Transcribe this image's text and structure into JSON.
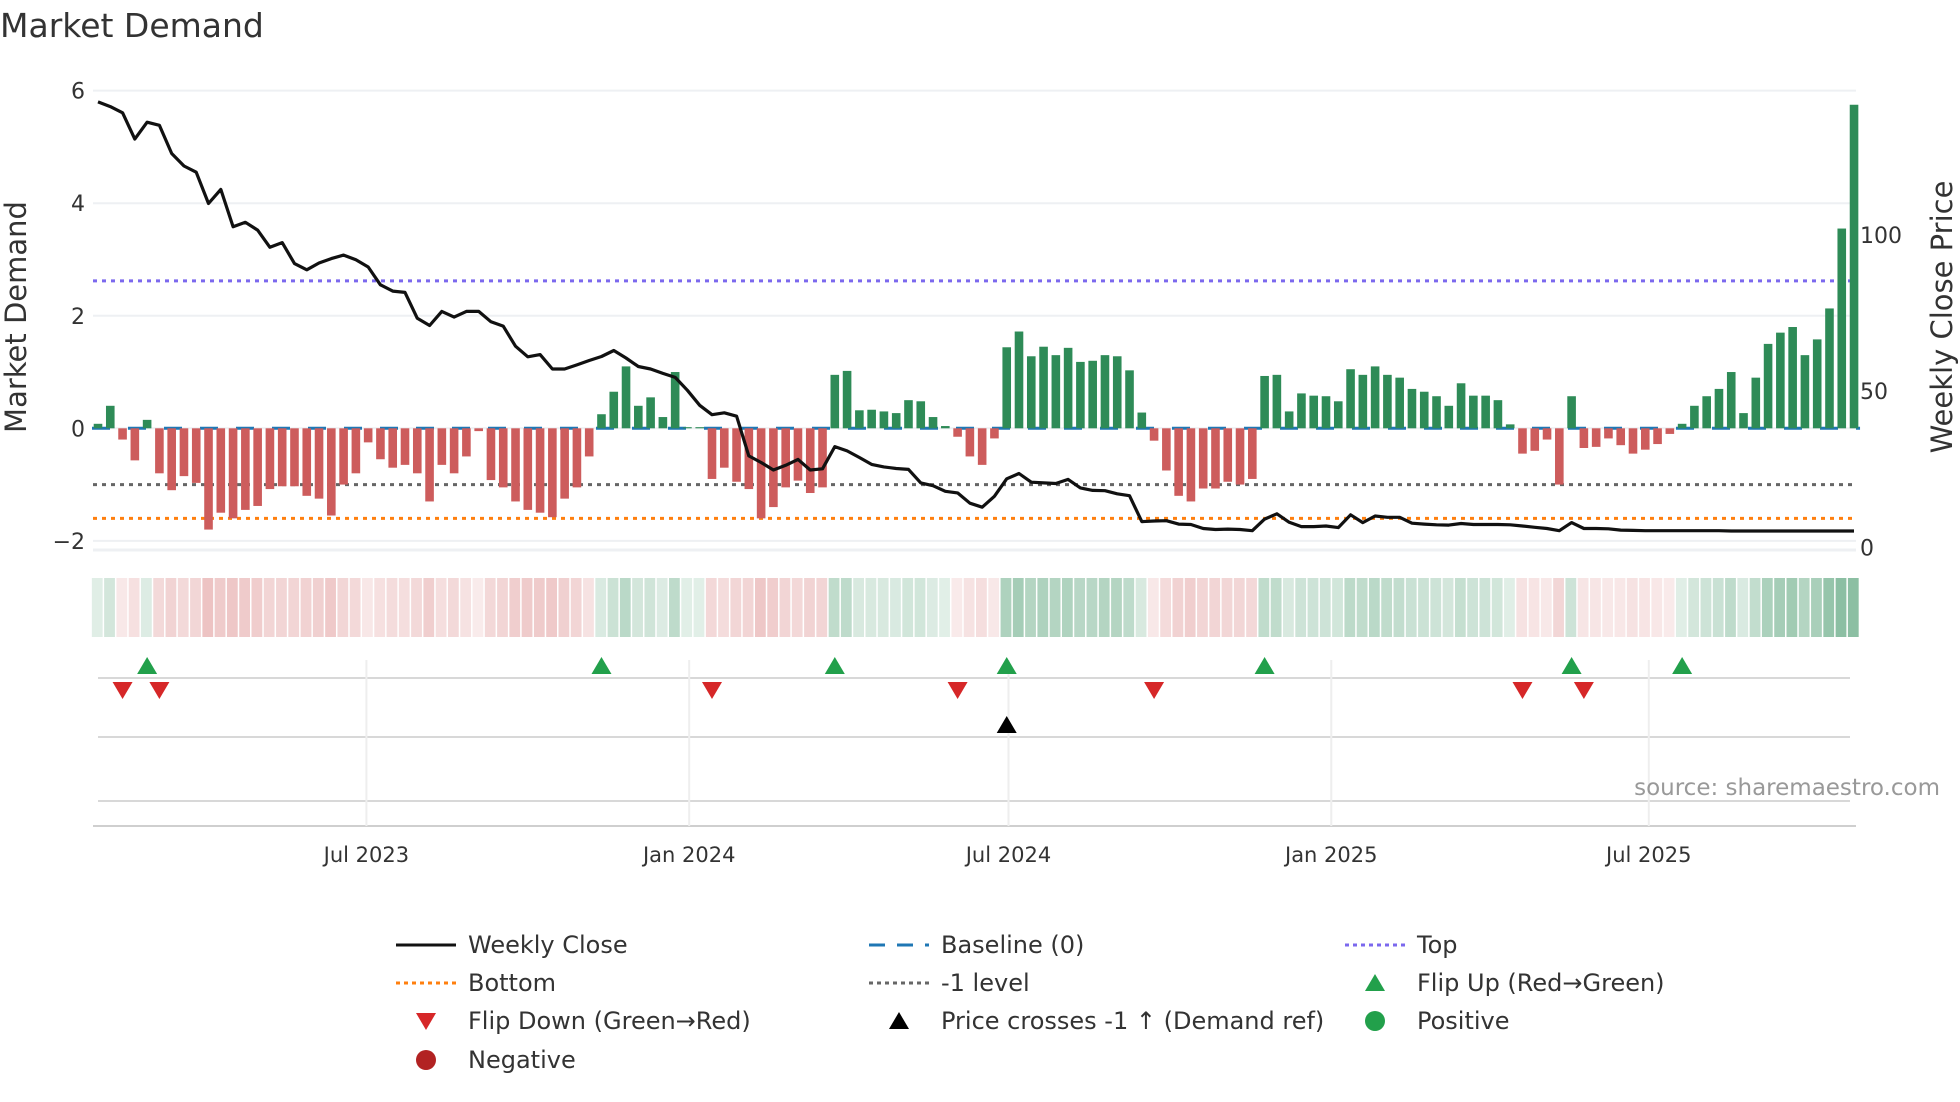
{
  "chart_data": {
    "type": "bar",
    "title": "Market Demand",
    "ylabel": "Market Demand",
    "y2label": "Weekly Close Price",
    "ylim": [
      -2.15,
      6.1
    ],
    "y2lim": [
      0,
      145
    ],
    "yticks": [
      -2,
      0,
      2,
      4,
      6
    ],
    "ytick_labels": [
      "−2",
      "0",
      "2",
      "4",
      "6"
    ],
    "y2ticks": [
      0,
      50,
      100
    ],
    "y2tick_labels": [
      "0",
      "50",
      "100"
    ],
    "x_start": "2023-01-29",
    "x_step_days": 7,
    "xticks": [
      "2023-07-01",
      "2024-01-01",
      "2024-07-01",
      "2025-01-01",
      "2025-07-01"
    ],
    "xtick_labels": [
      "Jul 2023",
      "Jan 2024",
      "Jul 2024",
      "Jan 2025",
      "Jul 2025"
    ],
    "levels": {
      "top": 2.62,
      "bottom": -1.6,
      "minus_one": -1,
      "baseline": 0
    },
    "demand": [
      0.08,
      0.4,
      -0.2,
      -0.57,
      0.15,
      -0.8,
      -1.1,
      -0.85,
      -0.97,
      -1.8,
      -1.5,
      -1.6,
      -1.45,
      -1.38,
      -1.08,
      -1.03,
      -1.03,
      -1.2,
      -1.25,
      -1.55,
      -1.0,
      -0.8,
      -0.25,
      -0.55,
      -0.7,
      -0.65,
      -0.8,
      -1.3,
      -0.65,
      -0.8,
      -0.5,
      -0.05,
      -0.92,
      -1.05,
      -1.3,
      -1.45,
      -1.5,
      -1.58,
      -1.25,
      -1.05,
      -0.5,
      0.25,
      0.65,
      1.1,
      0.4,
      0.55,
      0.2,
      1.0,
      0.02,
      0.02,
      -0.9,
      -0.7,
      -0.95,
      -1.08,
      -1.6,
      -1.4,
      -1.05,
      -0.93,
      -1.15,
      -1.05,
      0.95,
      1.02,
      0.32,
      0.33,
      0.3,
      0.27,
      0.5,
      0.48,
      0.2,
      0.04,
      -0.15,
      -0.5,
      -0.65,
      -0.18,
      1.44,
      1.72,
      1.28,
      1.45,
      1.3,
      1.43,
      1.18,
      1.2,
      1.3,
      1.28,
      1.03,
      0.28,
      -0.22,
      -0.75,
      -1.2,
      -1.3,
      -1.07,
      -1.07,
      -0.95,
      -1.0,
      -0.9,
      0.93,
      0.95,
      0.3,
      0.62,
      0.58,
      0.57,
      0.48,
      1.05,
      0.95,
      1.1,
      0.95,
      0.9,
      0.7,
      0.65,
      0.57,
      0.4,
      0.8,
      0.58,
      0.58,
      0.5,
      0.07,
      -0.45,
      -0.4,
      -0.2,
      -1.0,
      0.57,
      -0.35,
      -0.33,
      -0.18,
      -0.3,
      -0.45,
      -0.38,
      -0.28,
      -0.1,
      0.08,
      0.4,
      0.57,
      0.7,
      1.0,
      0.27,
      0.9,
      1.5,
      1.7,
      1.8,
      1.3,
      1.58,
      2.13,
      3.55,
      5.75
    ],
    "weekly_close": [
      142.5,
      141,
      139,
      130.6,
      136,
      135,
      126,
      122,
      120,
      110,
      114.5,
      102.6,
      104,
      101.5,
      96,
      97.5,
      90.8,
      88.8,
      91,
      92.4,
      93.5,
      92,
      89.7,
      84,
      82,
      81.6,
      73.3,
      71,
      75.5,
      73.7,
      75.5,
      75.5,
      72.2,
      70.8,
      64.4,
      61,
      61.7,
      57.1,
      57.1,
      58.4,
      59.8,
      61.1,
      63,
      60.6,
      57.9,
      57.1,
      55.7,
      54.4,
      50.3,
      45.5,
      42.5,
      43.1,
      42,
      29.3,
      27.2,
      24.8,
      26.3,
      28.2,
      24.8,
      25.2,
      32.3,
      30.9,
      28.8,
      26.6,
      25.8,
      25.3,
      25,
      20.7,
      19.8,
      18,
      17.5,
      14.2,
      12.9,
      16.4,
      22,
      23.7,
      20.9,
      20.7,
      20.5,
      21.8,
      19.1,
      18.3,
      18.2,
      17.2,
      16.6,
      8.3,
      8.5,
      8.6,
      7.5,
      7.4,
      6.1,
      5.8,
      5.9,
      5.8,
      5.4,
      9.1,
      10.8,
      8.1,
      6.7,
      6.7,
      6.9,
      6.4,
      10.5,
      8,
      10.1,
      9.7,
      9.7,
      7.8,
      7.5,
      7.3,
      7.2,
      7.7,
      7.4,
      7.4,
      7.4,
      7.3,
      6.9,
      6.5,
      6.1,
      5.4,
      8,
      6.1,
      6.1,
      6,
      5.6,
      5.5,
      5.4,
      5.4,
      5.4,
      5.4,
      5.4,
      5.4,
      5.4,
      5.3,
      5.3,
      5.3,
      5.3,
      5.3,
      5.3,
      5.3,
      5.3,
      5.3,
      5.3,
      5.3
    ],
    "flip_up_weeks": [
      4,
      41,
      60,
      74,
      95,
      120,
      129
    ],
    "flip_down_weeks": [
      2,
      5,
      50,
      70,
      86,
      116,
      121
    ],
    "price_cross_weeks": [
      74
    ],
    "legend": [
      {
        "label": "Weekly Close",
        "symbol": "line-solid",
        "color": "#111111"
      },
      {
        "label": "Baseline (0)",
        "symbol": "line-dash",
        "color": "#1f77b4"
      },
      {
        "label": "Top",
        "symbol": "line-dot",
        "color": "#7b68ee"
      },
      {
        "label": "Bottom",
        "symbol": "line-dot",
        "color": "#ff7f0e"
      },
      {
        "label": "-1 level",
        "symbol": "line-dot",
        "color": "#666666"
      },
      {
        "label": "Flip Up (Red→Green)",
        "symbol": "triangle-up",
        "color": "#22a04b"
      },
      {
        "label": "Flip Down (Green→Red)",
        "symbol": "triangle-down",
        "color": "#d62728"
      },
      {
        "label": "Price crosses -1 ↑ (Demand ref)",
        "symbol": "triangle-up",
        "color": "#000000"
      },
      {
        "label": "Positive",
        "symbol": "circle",
        "color": "#22a04b"
      },
      {
        "label": "Negative",
        "symbol": "circle",
        "color": "#b22222"
      }
    ],
    "legend_placement": "bottom",
    "source": "source: sharemaestro.com",
    "colors": {
      "positive": "#2e8b57",
      "negative": "#cd5c5c",
      "top": "#7b68ee",
      "bottom": "#ff7f0e",
      "minus_one": "#666666",
      "baseline": "#1f77b4",
      "price": "#111111"
    }
  }
}
